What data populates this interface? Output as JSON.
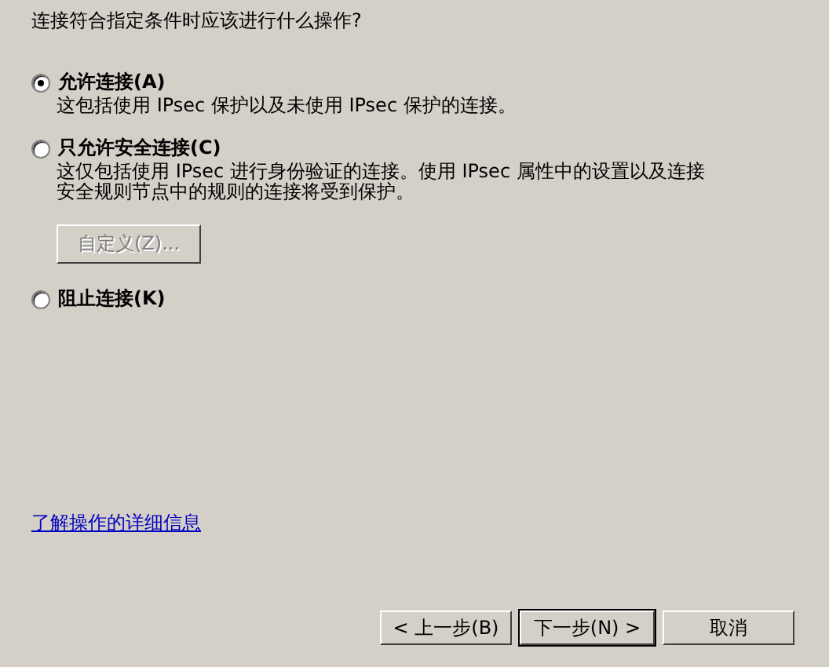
{
  "question": "连接符合指定条件时应该进行什么操作?",
  "options": [
    {
      "label": "允许连接(A)",
      "selected": true,
      "description": "这包括使用 IPsec 保护以及未使用 IPsec 保护的连接。"
    },
    {
      "label": "只允许安全连接(C)",
      "selected": false,
      "description": "这仅包括使用 IPsec 进行身份验证的连接。使用 IPsec 属性中的设置以及连接安全规则节点中的规则的连接将受到保护。",
      "button": {
        "label": "自定义(Z)...",
        "disabled": true
      }
    },
    {
      "label": "阻止连接(K)",
      "selected": false
    }
  ],
  "link": "了解操作的详细信息",
  "buttons": [
    {
      "label": "< 上一步(B)",
      "default": false
    },
    {
      "label": "下一步(N) >",
      "default": true
    },
    {
      "label": "取消",
      "default": false
    }
  ]
}
